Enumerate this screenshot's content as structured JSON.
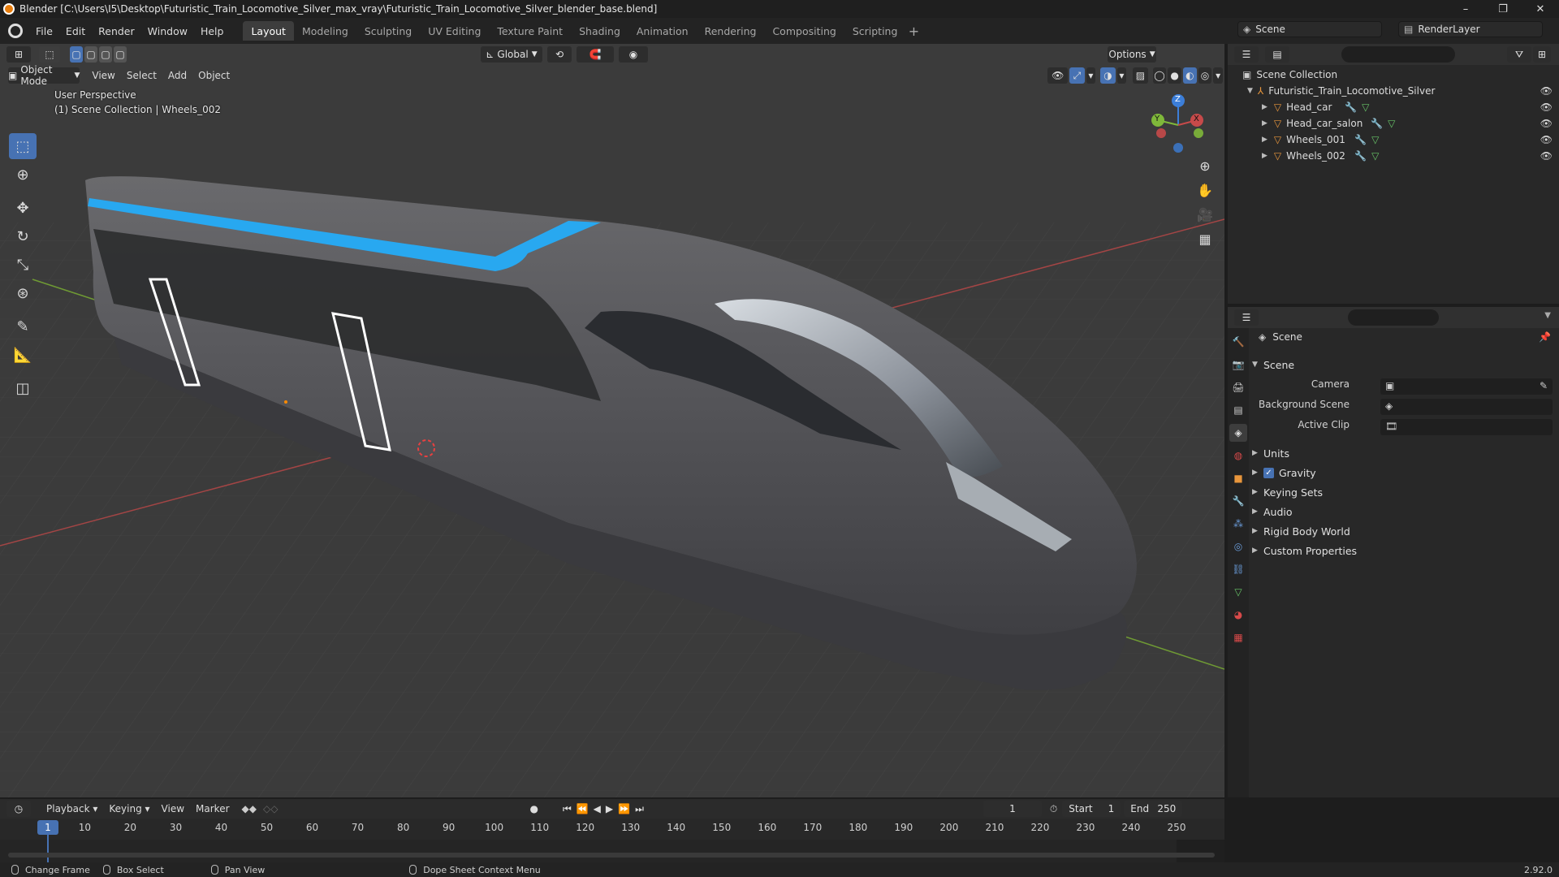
{
  "window": {
    "title": "Blender [C:\\Users\\I5\\Desktop\\Futuristic_Train_Locomotive_Silver_max_vray\\Futuristic_Train_Locomotive_Silver_blender_base.blend]",
    "controls": [
      "–",
      "❐",
      "✕"
    ]
  },
  "menubar": {
    "items": [
      "File",
      "Edit",
      "Render",
      "Window",
      "Help"
    ]
  },
  "workspaces": {
    "tabs": [
      "Layout",
      "Modeling",
      "Sculpting",
      "UV Editing",
      "Texture Paint",
      "Shading",
      "Animation",
      "Rendering",
      "Compositing",
      "Scripting"
    ],
    "active": "Layout"
  },
  "scene_selector": {
    "scene": "Scene",
    "view_layer": "RenderLayer"
  },
  "viewport": {
    "mode": "Object Mode",
    "menus": [
      "View",
      "Select",
      "Add",
      "Object"
    ],
    "transform_orientation": "Global",
    "options_label": "Options",
    "perspective_label": "User Perspective",
    "collection_label": "(1) Scene Collection | Wheels_002",
    "gizmo_axes": {
      "z": "Z",
      "y": "Y",
      "x": "X"
    }
  },
  "outliner": {
    "root": "Scene Collection",
    "collection": "Futuristic_Train_Locomotive_Silver",
    "objects": [
      "Head_car",
      "Head_car_salon",
      "Wheels_001",
      "Wheels_002"
    ]
  },
  "properties": {
    "context": "Scene",
    "panel_title": "Scene",
    "fields": {
      "camera_label": "Camera",
      "background_scene_label": "Background Scene",
      "active_clip_label": "Active Clip"
    },
    "subpanels": [
      "Units",
      "Gravity",
      "Keying Sets",
      "Audio",
      "Rigid Body World",
      "Custom Properties"
    ],
    "gravity_checked": true
  },
  "timeline": {
    "menus": [
      "Playback",
      "Keying",
      "View",
      "Marker"
    ],
    "current_frame": "1",
    "start_label": "Start",
    "start": "1",
    "end_label": "End",
    "end": "250",
    "ruler": [
      "1",
      "10",
      "20",
      "30",
      "40",
      "50",
      "60",
      "70",
      "80",
      "90",
      "100",
      "110",
      "120",
      "130",
      "140",
      "150",
      "160",
      "170",
      "180",
      "190",
      "200",
      "210",
      "220",
      "230",
      "240",
      "250"
    ]
  },
  "statusbar": {
    "items": [
      "Change Frame",
      "Box Select",
      "Pan View",
      "Dope Sheet Context Menu"
    ],
    "version": "2.92.0"
  },
  "colors": {
    "accent": "#4772b3",
    "viewport_bg": "#3b3b3b",
    "axis_x": "#c64a4a",
    "axis_y": "#7fb83a",
    "stripe": "#28a8f0"
  }
}
